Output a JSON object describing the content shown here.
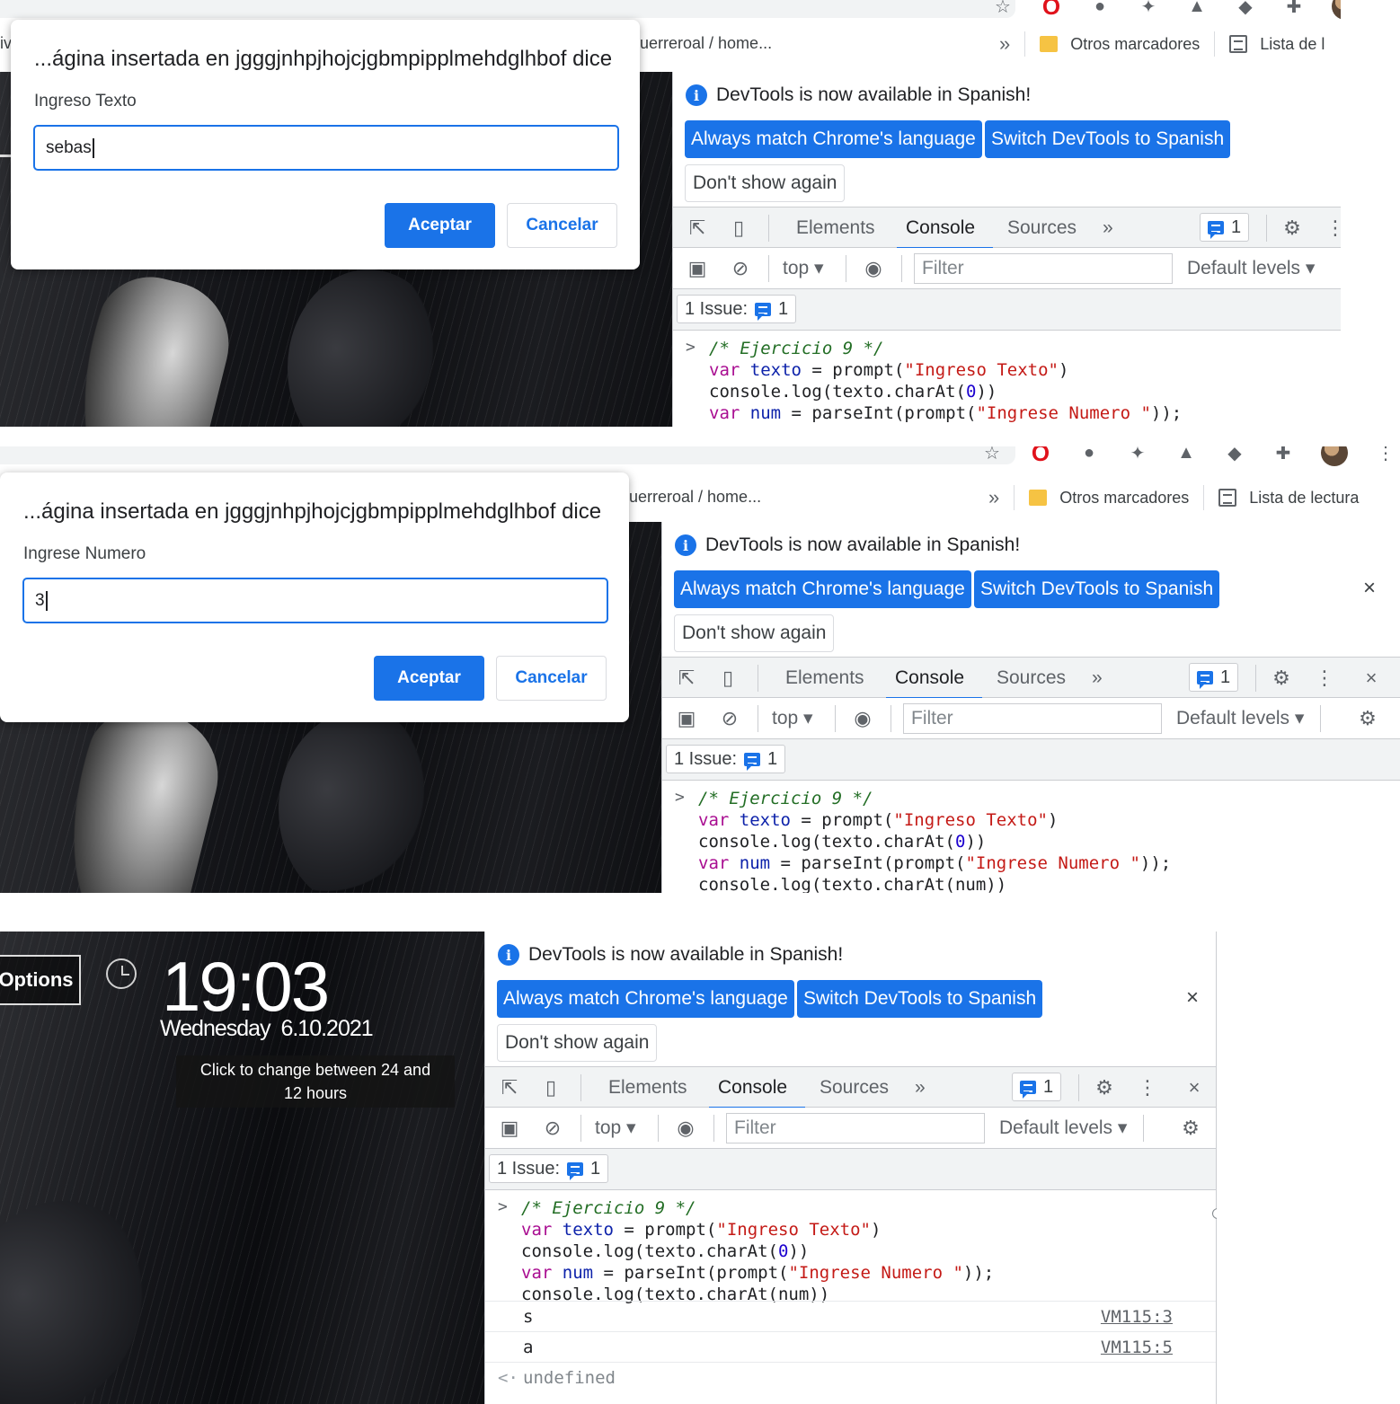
{
  "browser": {
    "bookmark_partial": "uerreroal / home...",
    "bookmark_left_partial": "iv",
    "overflow_chevron": "»",
    "other_bookmarks": "Otros marcadores",
    "reading_list_full": "Lista de lectura",
    "reading_list_cut": "Lista de l"
  },
  "dialog1": {
    "title": "...ágina insertada en jgggjnhpjhojcjgbmpipplmehdglhbof dice",
    "label": "Ingreso Texto",
    "value": "sebas",
    "accept": "Aceptar",
    "cancel": "Cancelar"
  },
  "dialog2": {
    "title": "...ágina insertada en jgggjnhpjhojcjgbmpipplmehdglhbof dice",
    "label": "Ingrese Numero",
    "value": "3",
    "accept": "Aceptar",
    "cancel": "Cancelar"
  },
  "devtools": {
    "info_text": "DevTools is now available in Spanish!",
    "btn_match": "Always match Chrome's language",
    "btn_switch": "Switch DevTools to Spanish",
    "btn_dont_show": "Don't show again",
    "close": "×",
    "tabs": [
      "Elements",
      "Console",
      "Sources"
    ],
    "more_tabs": "»",
    "issues_badge_count": "1",
    "context": "top",
    "filter_placeholder": "Filter",
    "levels": "Default levels",
    "issues_label": "1 Issue:",
    "issues_count": "1"
  },
  "console": {
    "lines": [
      "/* Ejercicio 9 */",
      "var texto = prompt(\"Ingreso Texto\")",
      "console.log(texto.charAt(0))",
      "var num = parseInt(prompt(\"Ingrese Numero \"));",
      "console.log(texto.charAt(num))"
    ],
    "outputs": [
      {
        "value": "s",
        "source": "VM115:3"
      },
      {
        "value": "a",
        "source": "VM115:5"
      }
    ],
    "return_value": "undefined"
  },
  "clock": {
    "options": "Options",
    "time": "19:03",
    "date": "Wednesday  6.10.2021",
    "tooltip_line1": "Click to change between 24 and",
    "tooltip_line2": "12 hours"
  },
  "colors": {
    "accent": "#1a73e8",
    "comment": "#236e25",
    "keyword": "#a90d91",
    "string": "#c41a16"
  }
}
